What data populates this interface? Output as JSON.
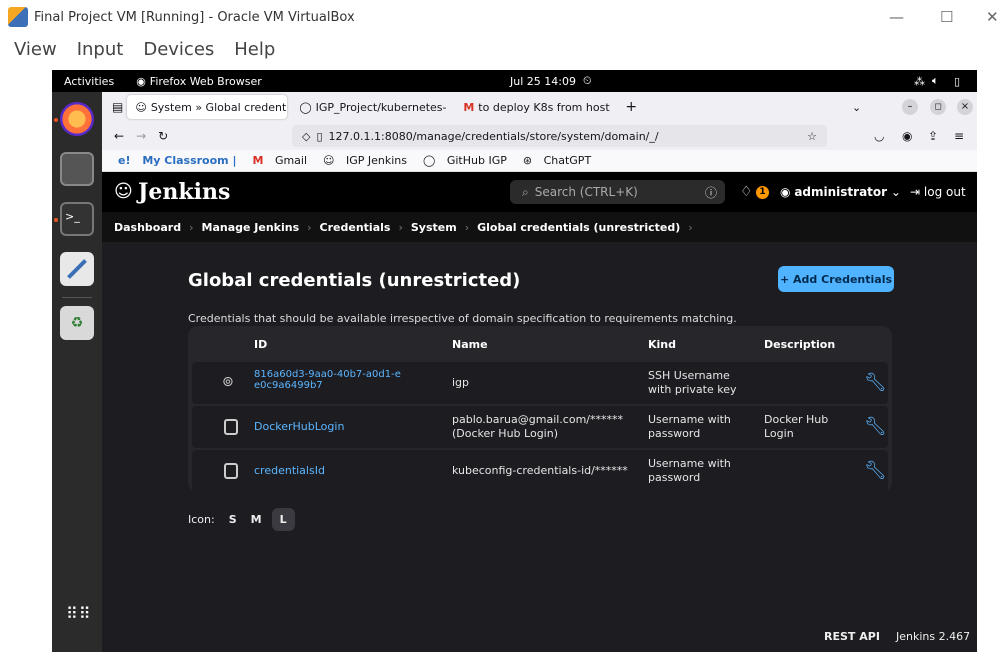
{
  "vbox": {
    "title": "Final Project VM [Running] - Oracle VM VirtualBox",
    "menu": [
      "View",
      "Input",
      "Devices",
      "Help"
    ]
  },
  "gnome": {
    "activities": "Activities",
    "app": "Firefox Web Browser",
    "clock": "Jul 25  14:09"
  },
  "firefox": {
    "tabs": [
      {
        "label": "System » Global credenti",
        "active": true
      },
      {
        "label": "IGP_Project/kubernetes-",
        "active": false
      },
      {
        "label": "to deploy K8s from host",
        "active": false
      }
    ],
    "url": "127.0.1.1:8080/manage/credentials/store/system/domain/_/",
    "bookmarks": [
      "My Classroom |",
      "Gmail",
      "IGP Jenkins",
      "GitHub IGP",
      "ChatGPT"
    ]
  },
  "jenkins": {
    "logo": "Jenkins",
    "search_placeholder": "Search (CTRL+K)",
    "notification_count": "1",
    "user": "administrator",
    "logout": "log out",
    "breadcrumb": [
      "Dashboard",
      "Manage Jenkins",
      "Credentials",
      "System",
      "Global credentials (unrestricted)"
    ],
    "title": "Global credentials (unrestricted)",
    "add_button": "+ Add Credentials",
    "description": "Credentials that should be available irrespective of domain specification to requirements matching.",
    "table": {
      "headers": [
        "ID",
        "Name",
        "Kind",
        "Description"
      ],
      "rows": [
        {
          "id": "816a60d3-9aa0-40b7-a0d1-ee0c9a6499b7",
          "name": "igp",
          "kind": "SSH Username with private key",
          "description": ""
        },
        {
          "id": "DockerHubLogin",
          "name": "pablo.barua@gmail.com/****** (Docker Hub Login)",
          "kind": "Username with password",
          "description": "Docker Hub Login"
        },
        {
          "id": "credentialsId",
          "name": "kubeconfig-credentials-id/******",
          "kind": "Username with password",
          "description": ""
        }
      ]
    },
    "icon_label": "Icon:",
    "icon_sizes": [
      "S",
      "M",
      "L"
    ],
    "rest_api": "REST API",
    "version": "Jenkins 2.467"
  }
}
